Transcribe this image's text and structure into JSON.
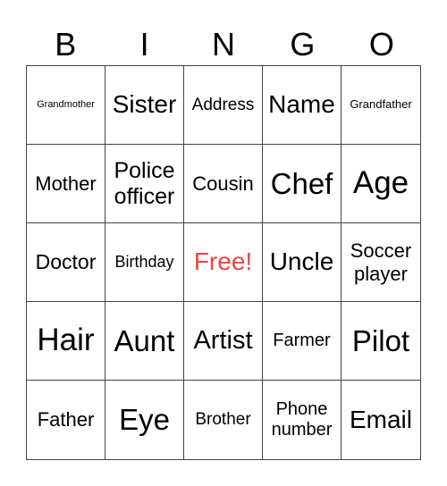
{
  "header": [
    "B",
    "I",
    "N",
    "G",
    "O"
  ],
  "free_color": "#ee4444",
  "cells": [
    {
      "text": "Grandmother",
      "size": 11
    },
    {
      "text": "Sister",
      "size": 28
    },
    {
      "text": "Address",
      "size": 19
    },
    {
      "text": "Name",
      "size": 28
    },
    {
      "text": "Grandfather",
      "size": 13
    },
    {
      "text": "Mother",
      "size": 22
    },
    {
      "text": "Police officer",
      "size": 25
    },
    {
      "text": "Cousin",
      "size": 22
    },
    {
      "text": "Chef",
      "size": 33
    },
    {
      "text": "Age",
      "size": 35
    },
    {
      "text": "Doctor",
      "size": 23
    },
    {
      "text": "Birthday",
      "size": 18
    },
    {
      "text": "Free!",
      "size": 28,
      "free": true
    },
    {
      "text": "Uncle",
      "size": 28
    },
    {
      "text": "Soccer player",
      "size": 22
    },
    {
      "text": "Hair",
      "size": 35
    },
    {
      "text": "Aunt",
      "size": 33
    },
    {
      "text": "Artist",
      "size": 29
    },
    {
      "text": "Farmer",
      "size": 20
    },
    {
      "text": "Pilot",
      "size": 33
    },
    {
      "text": "Father",
      "size": 22
    },
    {
      "text": "Eye",
      "size": 33
    },
    {
      "text": "Brother",
      "size": 19
    },
    {
      "text": "Phone number",
      "size": 20
    },
    {
      "text": "Email",
      "size": 28
    }
  ]
}
